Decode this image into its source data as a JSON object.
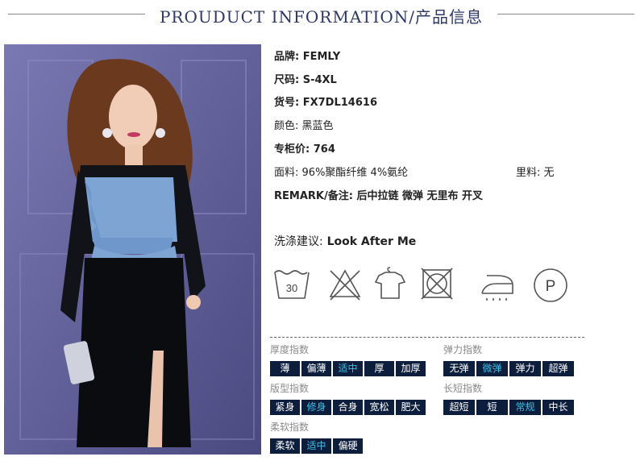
{
  "header": {
    "title": "PROUDUCT INFORMATION/产品信息"
  },
  "specs": {
    "brand": {
      "key": "品牌:",
      "value": "FEMLY"
    },
    "size": {
      "key": "尺码:",
      "value": "S-4XL"
    },
    "sku": {
      "key": "货号:",
      "value": "FX7DL14616"
    },
    "color": {
      "key": "颜色:",
      "value": "黑蓝色"
    },
    "price": {
      "key": "专柜价:",
      "value": "764"
    },
    "fabric": {
      "key": "面料:",
      "value": "96%聚酯纤维 4%氨纶"
    },
    "lining": {
      "key": "里料:",
      "value": "无"
    },
    "remark": {
      "key": "REMARK/备注:",
      "value": "后中拉链 微弹 无里布 开叉"
    },
    "wash": {
      "key": "洗涤建议:",
      "value": "Look After Me"
    }
  },
  "care_icons": [
    {
      "icon": "wash-30-icon",
      "text": "30"
    },
    {
      "icon": "no-bleach-icon"
    },
    {
      "icon": "hang-dry-icon"
    },
    {
      "icon": "no-tumble-dry-icon"
    },
    {
      "icon": "iron-icon"
    },
    {
      "icon": "dry-clean-p-icon",
      "text": "P"
    }
  ],
  "indices": {
    "thickness": {
      "label": "厚度指数",
      "options": [
        "薄",
        "偏薄",
        "适中",
        "厚",
        "加厚"
      ],
      "selected": "适中"
    },
    "elasticity": {
      "label": "弹力指数",
      "options": [
        "无弹",
        "微弹",
        "弹力",
        "超弹"
      ],
      "selected": "微弹"
    },
    "fit": {
      "label": "版型指数",
      "options": [
        "紧身",
        "修身",
        "合身",
        "宽松",
        "肥大"
      ],
      "selected": "修身"
    },
    "length": {
      "label": "长短指数",
      "options": [
        "超短",
        "短",
        "常规",
        "中长"
      ],
      "selected": "常规"
    },
    "softness": {
      "label": "柔软指数",
      "options": [
        "柔软",
        "适中",
        "偏硬"
      ],
      "selected": "适中"
    }
  },
  "colors": {
    "chip_bg": "#0d1e3c",
    "chip_text": "#ffffff",
    "chip_selected_text": "#35c1e6",
    "title_color": "#2e3866"
  }
}
